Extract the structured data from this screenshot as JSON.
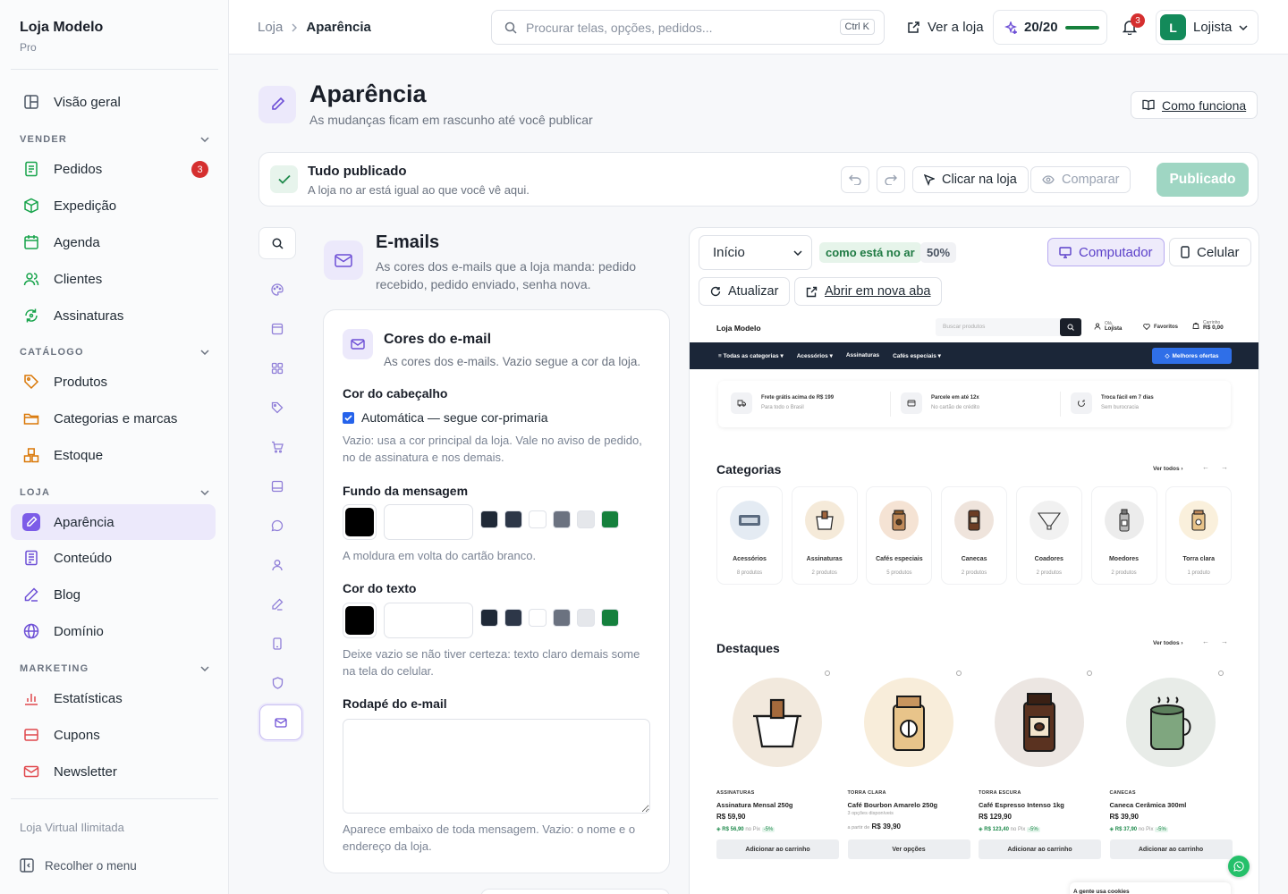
{
  "brand": {
    "name": "Loja Modelo",
    "plan": "Pro"
  },
  "nav": {
    "overview": "Visão geral",
    "sections": {
      "vender": "VENDER",
      "catalogo": "CATÁLOGO",
      "loja": "LOJA",
      "marketing": "MARKETING"
    },
    "items": {
      "pedidos": "Pedidos",
      "pedidos_badge": "3",
      "expedicao": "Expedição",
      "agenda": "Agenda",
      "clientes": "Clientes",
      "assinaturas": "Assinaturas",
      "produtos": "Produtos",
      "categorias": "Categorias e marcas",
      "estoque": "Estoque",
      "aparencia": "Aparência",
      "conteudo": "Conteúdo",
      "blog": "Blog",
      "dominio": "Domínio",
      "estatisticas": "Estatísticas",
      "cupons": "Cupons",
      "newsletter": "Newsletter"
    },
    "footer_plan": "Loja Virtual Ilimitada",
    "collapse": "Recolher o menu"
  },
  "topbar": {
    "crumb_root": "Loja",
    "crumb_current": "Aparência",
    "search_placeholder": "Procurar telas, opções, pedidos...",
    "search_kbd": "Ctrl K",
    "view_store": "Ver a loja",
    "progress": "20/20",
    "progress_fraction": 1.0,
    "notif_count": "3",
    "user_initial": "L",
    "user_name": "Lojista"
  },
  "page": {
    "title": "Aparência",
    "subtitle": "As mudanças ficam em rascunho até você publicar",
    "how_it_works": "Como funciona"
  },
  "status": {
    "title": "Tudo publicado",
    "subtitle": "A loja no ar está igual ao que você vê aqui.",
    "click_store": "Clicar na loja",
    "compare": "Comparar",
    "published": "Publicado"
  },
  "section": {
    "title": "E-mails",
    "desc": "As cores dos e-mails que a loja manda: pedido recebido, pedido enviado, senha nova."
  },
  "email_card": {
    "title": "Cores do e-mail",
    "subtitle": "As cores dos e-mails. Vazio segue a cor da loja.",
    "header_label": "Cor do cabeçalho",
    "header_auto": "Automática — segue cor-primaria",
    "header_help": "Vazio: usa a cor principal da loja. Vale no aviso de pedido, no de assinatura e nos demais.",
    "bg_label": "Fundo da mensagem",
    "bg_help": "A moldura em volta do cartão branco.",
    "text_label": "Cor do texto",
    "text_help": "Deixe vazio se não tiver certeza: texto claro demais some na tela do celular.",
    "footer_label": "Rodapé do e-mail",
    "footer_help": "Aparece embaixo de toda mensagem. Vazio: o nome e o endereço da loja.",
    "swatches": [
      "#1f2937",
      "#2d3748",
      "#ffffff",
      "#6b7280",
      "#e5e7eb",
      "#15803d"
    ]
  },
  "preview": {
    "page_select": "Início",
    "live": "como está no ar",
    "zoom": "50%",
    "desktop": "Computador",
    "mobile": "Celular",
    "refresh": "Atualizar",
    "new_tab": "Abrir em nova aba",
    "store": {
      "name": "Loja Modelo",
      "search": "Buscar produtos",
      "greet": "Olá,",
      "user": "Lojista",
      "fav": "Favoritos",
      "cart": "Carrinho",
      "cart_total": "R$ 0,00",
      "menu": [
        "Todas as categorias",
        "Acessórios",
        "Assinaturas",
        "Cafés especiais"
      ],
      "offers": "Melhores ofertas",
      "benefits": [
        {
          "t": "Frete grátis acima de R$ 199",
          "s": "Para todo o Brasil"
        },
        {
          "t": "Parcele em até 12x",
          "s": "No cartão de crédito"
        },
        {
          "t": "Troca fácil em 7 dias",
          "s": "Sem burocracia"
        }
      ],
      "categories_title": "Categorias",
      "see_all": "Ver todos",
      "categories": [
        {
          "n": "Acessórios",
          "c": "8 produtos"
        },
        {
          "n": "Assinaturas",
          "c": "2 produtos"
        },
        {
          "n": "Cafés especiais",
          "c": "5 produtos"
        },
        {
          "n": "Canecas",
          "c": "2 produtos"
        },
        {
          "n": "Coadores",
          "c": "2 produtos"
        },
        {
          "n": "Moedores",
          "c": "2 produtos"
        },
        {
          "n": "Torra clara",
          "c": "1 produto"
        }
      ],
      "featured_title": "Destaques",
      "products": [
        {
          "k": "ASSINATURAS",
          "n": "Assinatura Mensal 250g",
          "p": "R$ 59,90",
          "x": "R$ 56,90",
          "pix": "no Pix",
          "off": "-5%",
          "b": "Adicionar ao carrinho",
          "o": ""
        },
        {
          "k": "TORRA CLARA",
          "n": "Café Bourbon Amarelo 250g",
          "p": "R$ 39,90",
          "x": "",
          "pix": "",
          "off": "",
          "b": "Ver opções",
          "o": "3 opções disponíveis",
          "from": "a partir de"
        },
        {
          "k": "TORRA ESCURA",
          "n": "Café Espresso Intenso 1kg",
          "p": "R$ 129,90",
          "x": "R$ 123,40",
          "pix": "no Pix",
          "off": "-5%",
          "b": "Adicionar ao carrinho",
          "o": ""
        },
        {
          "k": "CANECAS",
          "n": "Caneca Cerâmica 300ml",
          "p": "R$ 39,90",
          "x": "R$ 37,90",
          "pix": "no Pix",
          "off": "-5%",
          "b": "Adicionar ao carrinho",
          "o": ""
        }
      ],
      "cookies": "A gente usa cookies"
    }
  }
}
